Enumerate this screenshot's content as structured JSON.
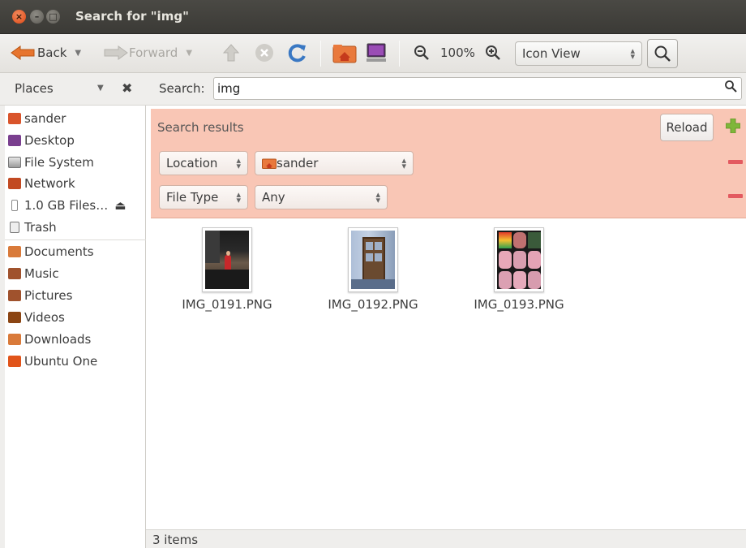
{
  "window": {
    "title": "Search for \"img\"",
    "close_glyph": "×",
    "min_glyph": "–",
    "max_glyph": "□"
  },
  "toolbar": {
    "back_label": "Back",
    "forward_label": "Forward",
    "zoom_level": "100%",
    "view_mode": "Icon View"
  },
  "places": {
    "header": "Places",
    "items": [
      {
        "label": "sander",
        "icon": "home-folder-icon",
        "color": "#d9542b"
      },
      {
        "label": "Desktop",
        "icon": "desktop-icon",
        "color": "#7a3f8f"
      },
      {
        "label": "File System",
        "icon": "drive-icon",
        "color": "#9a9a9a"
      },
      {
        "label": "Network",
        "icon": "network-icon",
        "color": "#c24a22"
      },
      {
        "label": "1.0 GB Files…",
        "icon": "usb-drive-icon",
        "color": "#8a8a8a"
      },
      {
        "label": "Trash",
        "icon": "trash-icon",
        "color": "#8a8a8a"
      },
      {
        "label": "Documents",
        "icon": "documents-folder-icon",
        "color": "#d97a3a"
      },
      {
        "label": "Music",
        "icon": "music-folder-icon",
        "color": "#a0522d"
      },
      {
        "label": "Pictures",
        "icon": "pictures-folder-icon",
        "color": "#a0522d"
      },
      {
        "label": "Videos",
        "icon": "videos-folder-icon",
        "color": "#8b4513"
      },
      {
        "label": "Downloads",
        "icon": "downloads-folder-icon",
        "color": "#d97a3a"
      },
      {
        "label": "Ubuntu One",
        "icon": "ubuntu-one-folder-icon",
        "color": "#e1541a"
      }
    ]
  },
  "search": {
    "label": "Search:",
    "query": "img"
  },
  "results": {
    "title": "Search results",
    "reload_label": "Reload",
    "criteria": [
      {
        "type": "Location",
        "value": "sander"
      },
      {
        "type": "File Type",
        "value": "Any"
      }
    ]
  },
  "files": [
    {
      "name": "IMG_0191.PNG"
    },
    {
      "name": "IMG_0192.PNG"
    },
    {
      "name": "IMG_0193.PNG"
    }
  ],
  "status": {
    "text": "3 items"
  },
  "colors": {
    "accent": "#dd4814",
    "results_panel": "#f9c6b5",
    "remove_criterion": "#e35a60",
    "add_criterion": "#7fb63a"
  }
}
